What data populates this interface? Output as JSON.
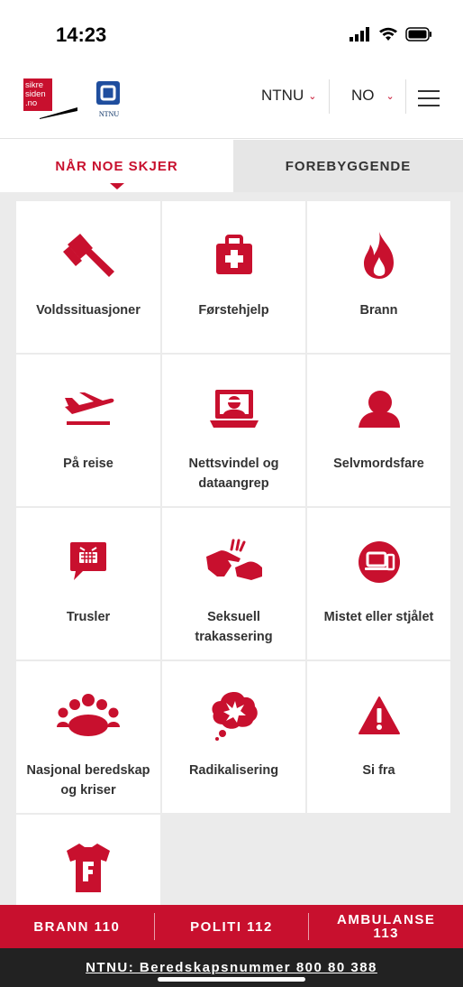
{
  "status_bar": {
    "time": "14:23"
  },
  "header": {
    "logo_text": [
      "sikre",
      "siden",
      ".no"
    ],
    "ntnu_logo_label": "NTNU",
    "org_selector": "NTNU",
    "lang_selector": "NO"
  },
  "tabs": [
    {
      "label": "NÅR NOE SKJER",
      "active": true
    },
    {
      "label": "FOREBYGGENDE",
      "active": false
    }
  ],
  "tiles": [
    {
      "label": "Voldssituasjoner",
      "icon": "gavel-icon"
    },
    {
      "label": "Førstehjelp",
      "icon": "first-aid-kit-icon"
    },
    {
      "label": "Brann",
      "icon": "flame-icon"
    },
    {
      "label": "På reise",
      "icon": "airplane-icon"
    },
    {
      "label": "Nettsvindel og dataangrep",
      "icon": "hacker-laptop-icon"
    },
    {
      "label": "Selvmordsfare",
      "icon": "person-icon"
    },
    {
      "label": "Trusler",
      "icon": "threat-speech-bubble-icon"
    },
    {
      "label": "Seksuell trakassering",
      "icon": "harassment-hands-icon"
    },
    {
      "label": "Mistet eller stjålet",
      "icon": "lost-device-icon"
    },
    {
      "label": "Nasjonal beredskap og kriser",
      "icon": "people-group-icon"
    },
    {
      "label": "Radikalisering",
      "icon": "thought-bubble-icon"
    },
    {
      "label": "Si fra",
      "icon": "warning-icon"
    },
    {
      "label": "",
      "icon": "t-shirt-icon"
    }
  ],
  "emergency": {
    "fire": "BRANN 110",
    "police": "POLITI 112",
    "ambulance_line1": "AMBULANSE",
    "ambulance_line2": "113"
  },
  "ntnu_emergency": "NTNU: Beredskapsnummer 800 80 388",
  "colors": {
    "accent": "#c8102e",
    "tab_inactive_bg": "#e6e6e6",
    "dark_bar": "#222222"
  }
}
